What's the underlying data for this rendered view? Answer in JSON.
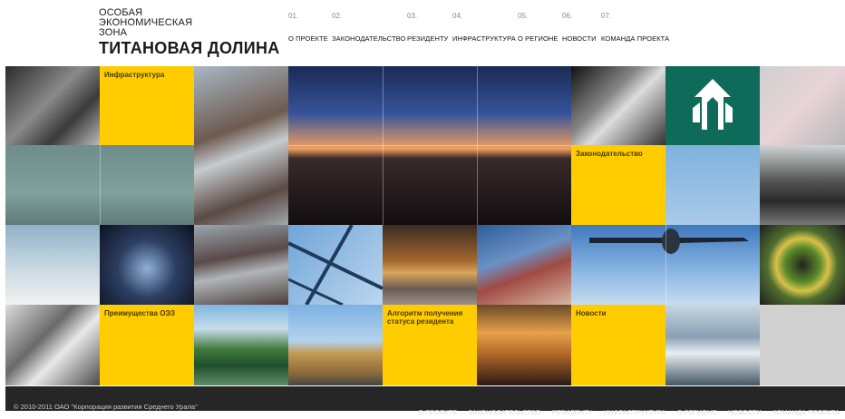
{
  "logo": {
    "line1": "ОСОБАЯ",
    "line2": "ЭКОНОМИЧЕСКАЯ",
    "line3": "ЗОНА",
    "line4": "ТИТАНОВАЯ ДОЛИНА"
  },
  "nav": [
    {
      "num": "01.",
      "label": "О ПРОЕКТЕ"
    },
    {
      "num": "02.",
      "label": "ЗАКОНОДАТЕЛЬСТВО"
    },
    {
      "num": "03.",
      "label": "РЕЗИДЕНТУ"
    },
    {
      "num": "04.",
      "label": "ИНФРАСТРУКТУРА"
    },
    {
      "num": "05.",
      "label": "О РЕГИОНЕ"
    },
    {
      "num": "06.",
      "label": "НОВОСТИ"
    },
    {
      "num": "07.",
      "label": "КОМАНДА ПРОЕКТА"
    }
  ],
  "tiles": {
    "infrastructure": "Инфраструктура",
    "legislation": "Законодательство",
    "advantages": "Преимущества ОЭЗ",
    "algorithm": "Алгоритм получения статуса резидента",
    "news": "Новости"
  },
  "footer": {
    "copyright": "© 2010-2011 ОАО \"Корпорация развития Среднего Урала\"",
    "nav": [
      "О ПРОЕКТЕ",
      "ЗАКОНОДАТЕЛЬСТВО",
      "РЕЗИДЕНТУ",
      "ИНФРАСТРУКТУРА",
      "О РЕГИОНЕ",
      "НОВОСТИ",
      "КОМАНДА ПРОЕКТА"
    ]
  },
  "colors": {
    "accent_yellow": "#ffcc00",
    "footer_bg": "#262626"
  }
}
